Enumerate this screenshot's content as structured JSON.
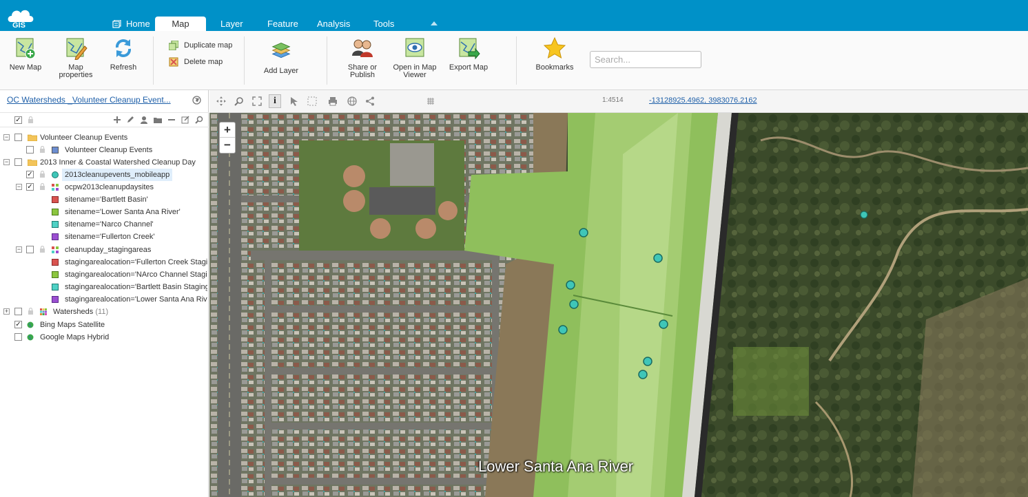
{
  "app": {
    "logo_text": "GIS"
  },
  "tabs": [
    {
      "label": "Home"
    },
    {
      "label": "Map"
    },
    {
      "label": "Layer"
    },
    {
      "label": "Feature"
    },
    {
      "label": "Analysis"
    },
    {
      "label": "Tools"
    }
  ],
  "ribbon": {
    "new_map": "New Map",
    "map_properties": "Map properties",
    "refresh": "Refresh",
    "duplicate_map": "Duplicate map",
    "delete_map": "Delete map",
    "add_layer": "Add Layer",
    "share_publish": "Share or Publish",
    "open_viewer": "Open in Map Viewer",
    "export_map": "Export Map",
    "bookmarks": "Bookmarks",
    "search_placeholder": "Search..."
  },
  "left_panel": {
    "map_title": "OC Watersheds _Volunteer Cleanup Event..."
  },
  "layers": {
    "group_volunteer": "Volunteer Cleanup Events",
    "volunteer_layer": "Volunteer Cleanup Events",
    "group_2013": "2013 Inner & Coastal Watershed Cleanup Day",
    "mobileapp": "2013cleanupevents_mobileapp",
    "cleanupdaysites": "ocpw2013cleanupdaysites",
    "site1": "sitename='Bartlett Basin'",
    "site2": "sitename='Lower Santa Ana River'",
    "site3": "sitename='Narco Channel'",
    "site4": "sitename='Fullerton Creek'",
    "stagingareas": "cleanupday_stagingareas",
    "stage1": "stagingarealocation='Fullerton Creek Staging'",
    "stage2": "stagingarealocation='NArco Channel Staging'",
    "stage3": "stagingarealocation='Bartlett Basin Staging'",
    "stage4": "stagingarealocation='Lower Santa Ana River Staging'",
    "watersheds": "Watersheds",
    "watersheds_count": "(11)",
    "bing": "Bing Maps Satellite",
    "google": "Google Maps Hybrid"
  },
  "legend_colors": {
    "red": "#d9534f",
    "green": "#8cc63f",
    "teal": "#4fd1c5",
    "purple": "#9b4fd1",
    "blue": "#6c8ed1",
    "point": "#3fc6b8"
  },
  "map_toolbar": {
    "scale": "1:4514",
    "coordinates": "-13128925.4962, 3983076.2162"
  },
  "map": {
    "zoom_in": "+",
    "zoom_out": "−",
    "label": "Lower Santa Ana River"
  }
}
